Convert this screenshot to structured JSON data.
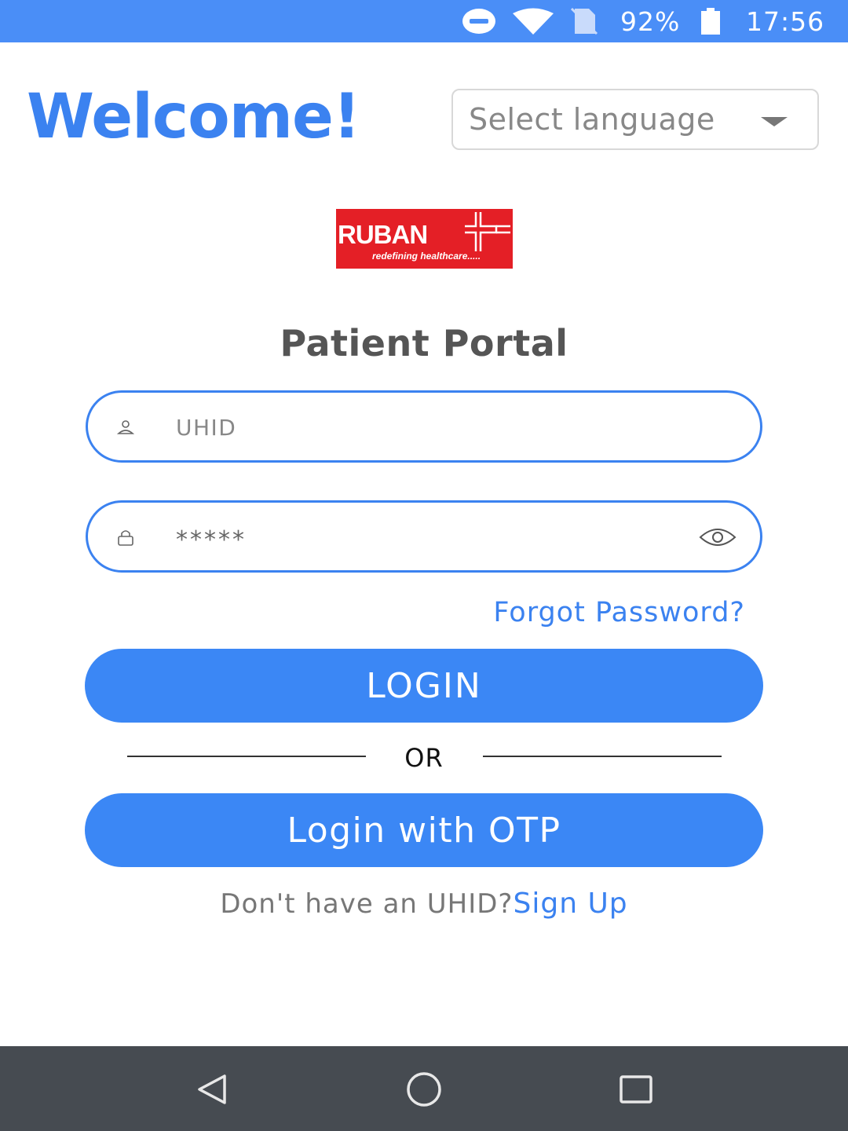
{
  "status_bar": {
    "battery_percent": "92%",
    "time": "17:56",
    "icons": [
      "do-not-disturb-icon",
      "wifi-icon",
      "no-sim-icon",
      "battery-icon"
    ]
  },
  "header": {
    "welcome": "Welcome!",
    "language_select": {
      "placeholder": "Select language"
    }
  },
  "logo": {
    "brand": "RUBAN",
    "tagline": "redefining healthcare....."
  },
  "portal_title": "Patient Portal",
  "form": {
    "uhid": {
      "placeholder": "UHID",
      "icon": "user-icon"
    },
    "password": {
      "value": "*****",
      "icon": "lock-icon",
      "toggle_icon": "eye-icon"
    },
    "forgot_password": "Forgot Password?",
    "login_button": "LOGIN",
    "or_label": "OR",
    "otp_button": "Login with OTP",
    "signup_prompt": "Don't have an UHID?",
    "signup_link": "Sign Up"
  },
  "nav_bar": {
    "icons": [
      "back-icon",
      "home-icon",
      "recents-icon"
    ]
  },
  "colors": {
    "status_bar": "#4a8ef7",
    "accent": "#3b82f0",
    "button": "#3b87f5",
    "logo_red": "#e41f26",
    "nav_bar": "#464b51"
  }
}
